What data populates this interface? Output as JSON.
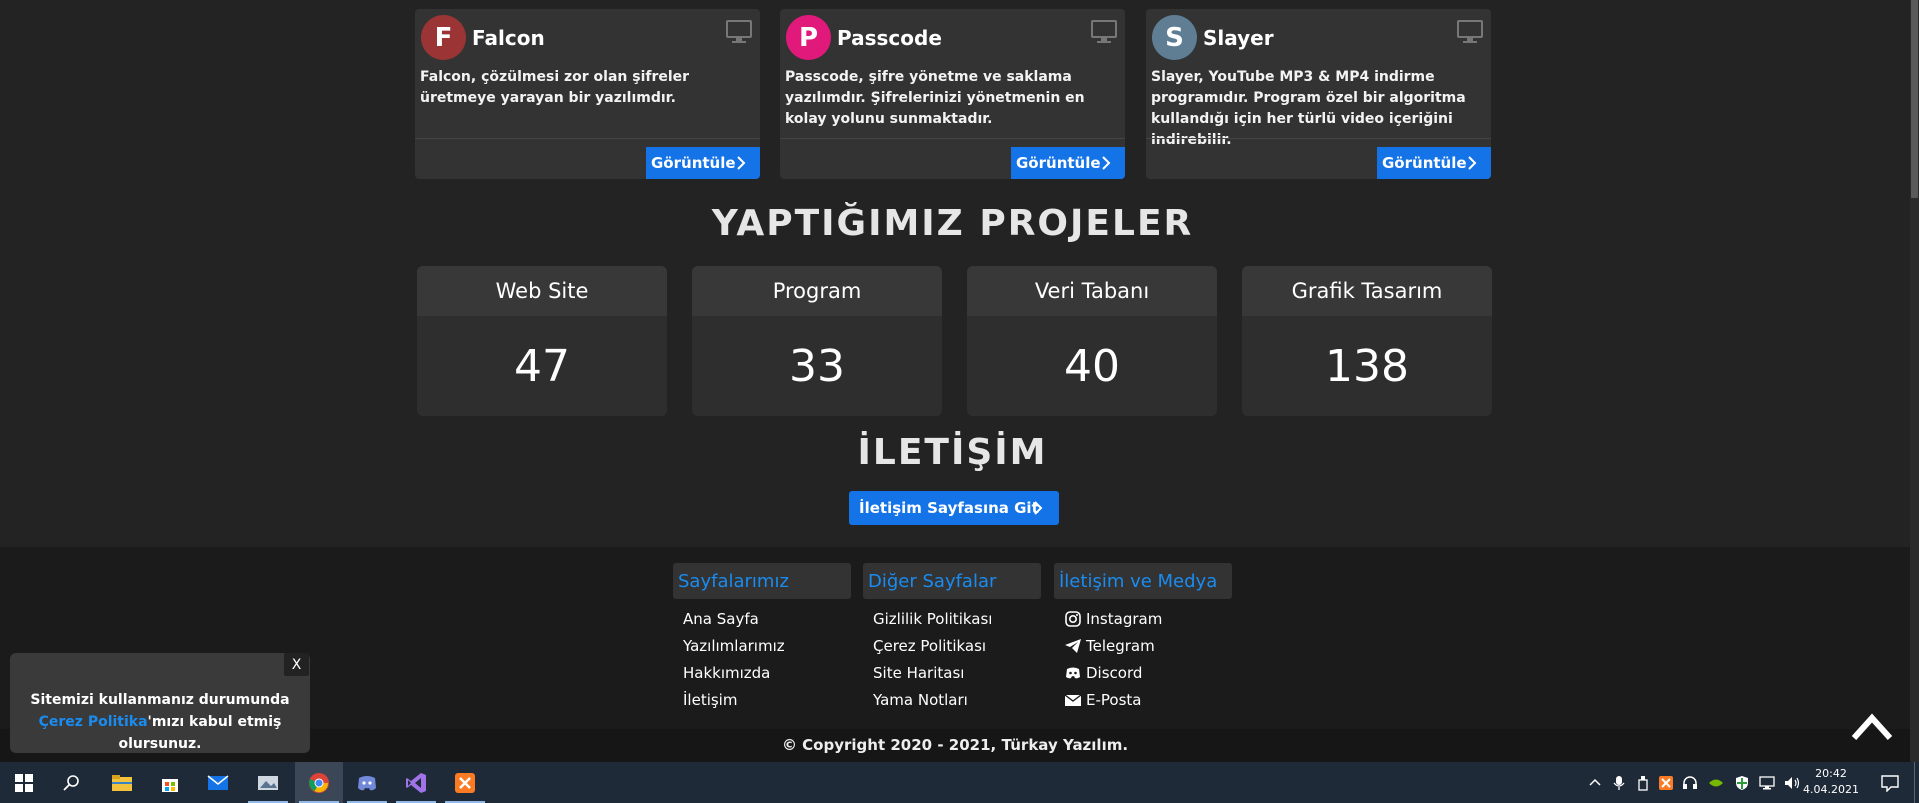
{
  "projects": [
    {
      "name": "Falcon",
      "logo_letter": "F",
      "logo_color": "#a03a3a",
      "description": "Falcon, çözülmesi zor olan şifreler üretmeye yarayan bir yazılımdır.",
      "button": "Görüntüle"
    },
    {
      "name": "Passcode",
      "logo_letter": "P",
      "logo_color": "#e0197a",
      "description": "Passcode, şifre yönetme ve saklama yazılımdır. Şifrelerinizi yönetmenin en kolay yolunu sunmaktadır.",
      "button": "Görüntüle"
    },
    {
      "name": "Slayer",
      "logo_letter": "S",
      "logo_color": "#5f7e94",
      "description": "Slayer, YouTube MP3 & MP4 indirme programıdır. Program özel bir algoritma kullandığı için her türlü video içeriğini indirebilir.",
      "button": "Görüntüle"
    }
  ],
  "stats_title": "YAPTIĞIMIZ PROJELER",
  "stats": [
    {
      "label": "Web Site",
      "value": "47"
    },
    {
      "label": "Program",
      "value": "33"
    },
    {
      "label": "Veri Tabanı",
      "value": "40"
    },
    {
      "label": "Grafik Tasarım",
      "value": "138"
    }
  ],
  "contact_title": "İLETİŞİM",
  "contact_button": "İletişim Sayfasına Git",
  "footer": {
    "columns": [
      {
        "title": "Sayfalarımız",
        "items": [
          {
            "label": "Ana Sayfa"
          },
          {
            "label": "Yazılımlarımız"
          },
          {
            "label": "Hakkımızda"
          },
          {
            "label": "İletişim"
          }
        ]
      },
      {
        "title": "Diğer Sayfalar",
        "items": [
          {
            "label": "Gizlilik Politikası"
          },
          {
            "label": "Çerez Politikası"
          },
          {
            "label": "Site Haritası"
          },
          {
            "label": "Yama Notları"
          }
        ]
      },
      {
        "title": "İletişim ve Medya",
        "items": [
          {
            "label": "Instagram",
            "icon": "instagram-icon"
          },
          {
            "label": "Telegram",
            "icon": "telegram-icon"
          },
          {
            "label": "Discord",
            "icon": "discord-icon"
          },
          {
            "label": "E-Posta",
            "icon": "mail-icon"
          }
        ]
      }
    ],
    "copyright": "© Copyright 2020 - 2021, Türkay Yazılım."
  },
  "cookie": {
    "close": "X",
    "text_before": "Sitemizi kullanmanız durumunda ",
    "link": "Çerez Politika",
    "text_after": "'mızı kabul etmiş olursunuz."
  },
  "taskbar": {
    "time": "20:42",
    "date": "4.04.2021",
    "apps": [
      "windows-start-icon",
      "search-icon",
      "file-explorer-icon",
      "store-icon",
      "mail-icon",
      "photos-icon",
      "chrome-icon",
      "discord-icon",
      "visual-studio-icon",
      "xampp-icon"
    ]
  },
  "colors": {
    "accent": "#1473e6",
    "link": "#1a8cf0",
    "background": "#232323"
  }
}
